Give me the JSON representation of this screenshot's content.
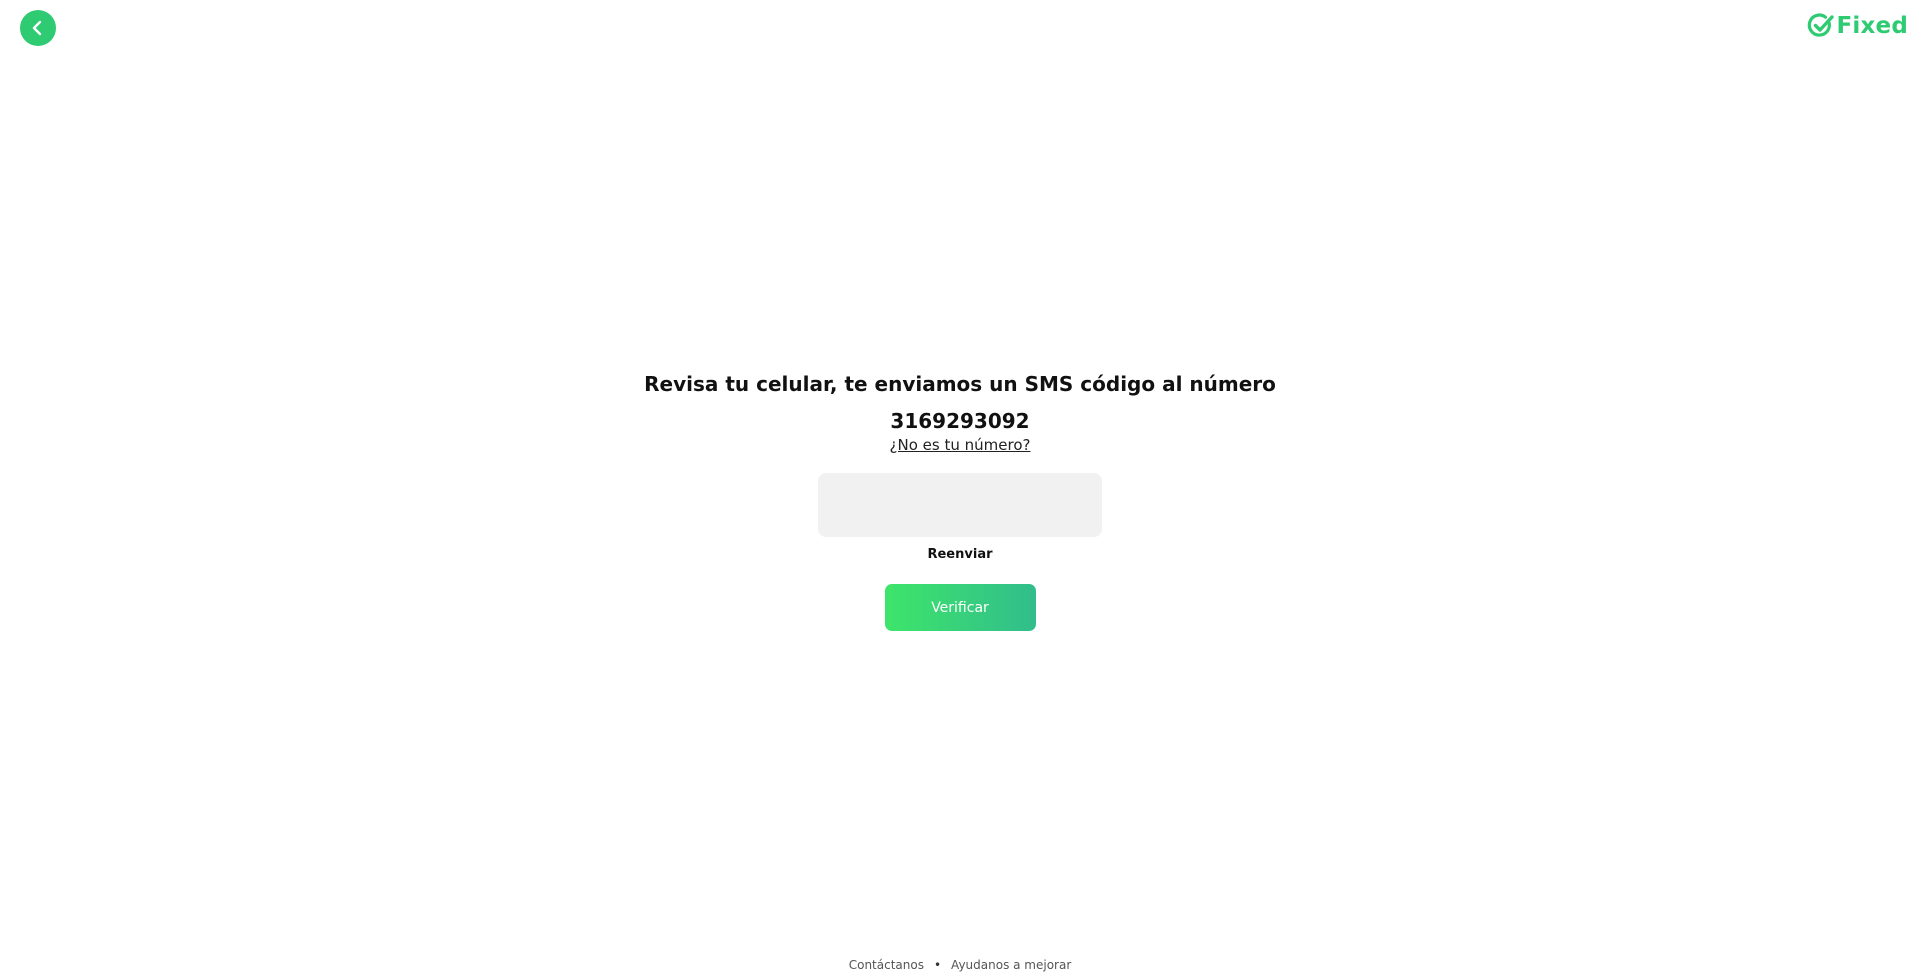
{
  "header": {
    "back_icon": "chevron-left-icon",
    "logo_text": "Fixed",
    "logo_icon": "check-circle-icon",
    "accent_color": "#2ecb73"
  },
  "verification": {
    "title": "Revisa tu celular, te enviamos un SMS código al número",
    "phone_number": "3169293092",
    "change_number_link": "¿No es tu número?",
    "code_value": "",
    "resend_label": "Reenviar",
    "verify_label": "Verificar",
    "button_gradient": [
      "#3ee56a",
      "#31bd8c"
    ]
  },
  "footer": {
    "contact_label": "Contáctanos",
    "separator": "•",
    "feedback_label": "Ayudanos a mejorar"
  }
}
